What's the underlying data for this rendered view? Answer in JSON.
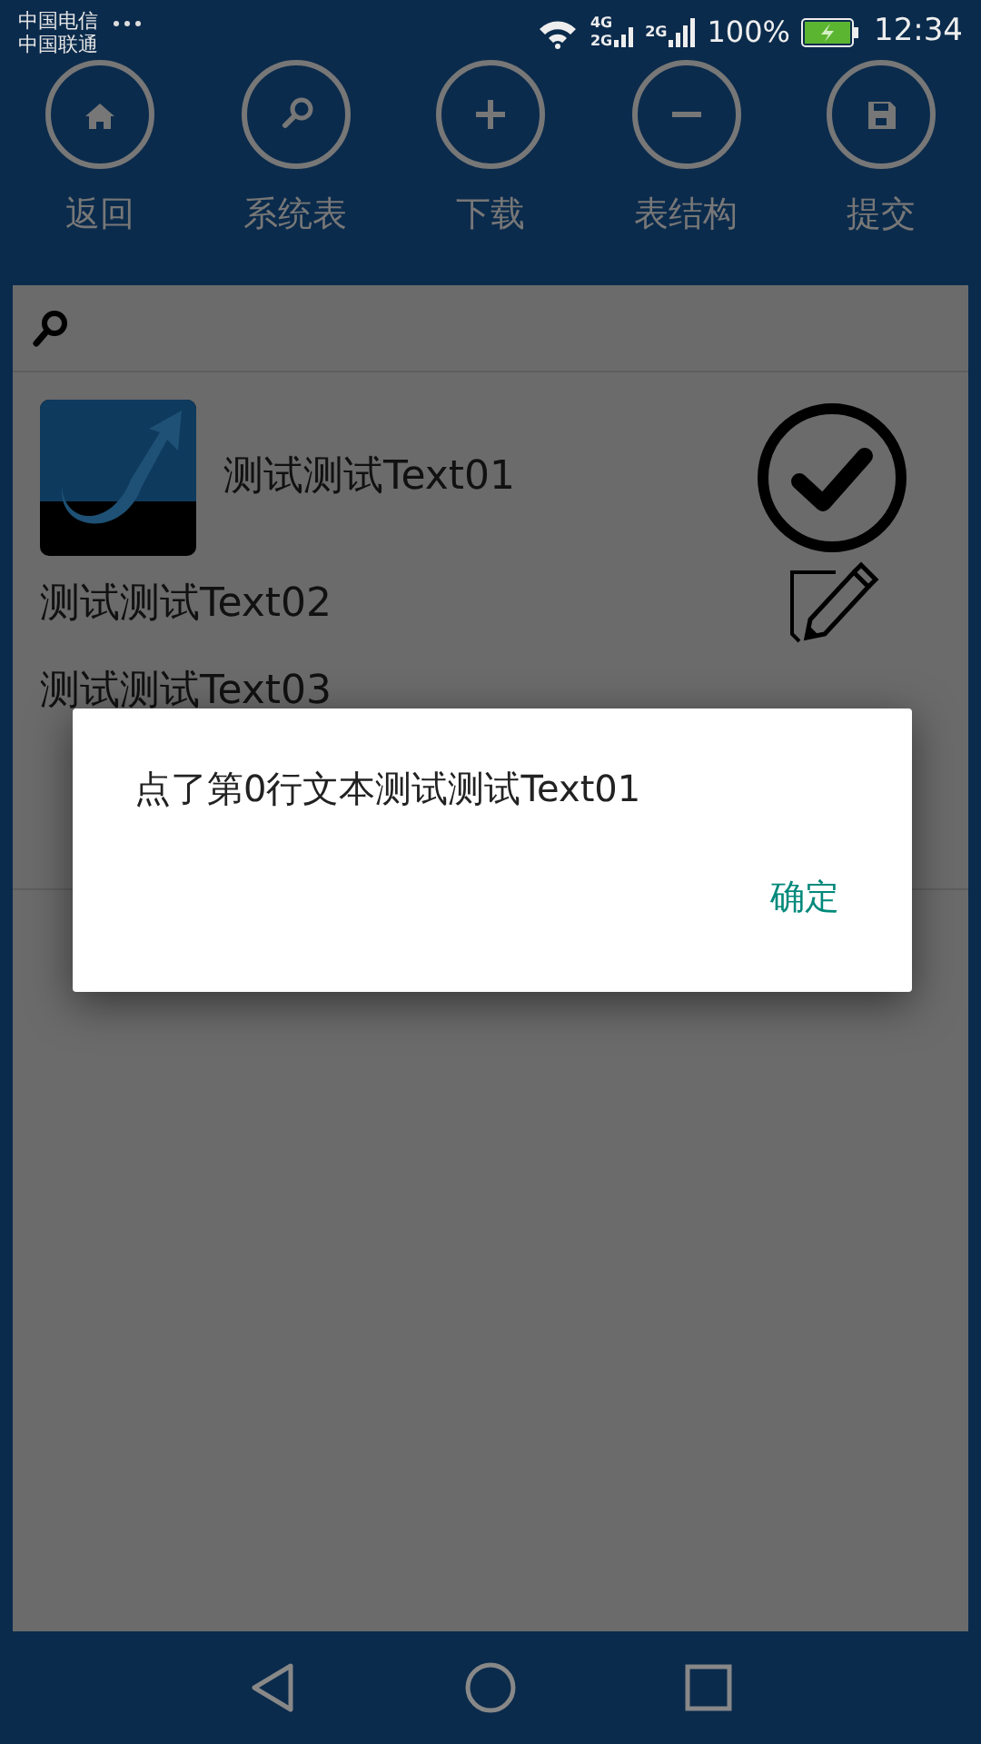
{
  "status_bar": {
    "carriers": [
      "中国电信",
      "中国联通"
    ],
    "signals": [
      {
        "labels": [
          "4G",
          "2G"
        ]
      },
      {
        "labels": [
          "2G"
        ]
      }
    ],
    "battery": "100%",
    "time": "12:34"
  },
  "toolbar": [
    {
      "label": "返回",
      "kind": "home"
    },
    {
      "label": "系统表",
      "kind": "search"
    },
    {
      "label": "下载",
      "kind": "plus"
    },
    {
      "label": "表结构",
      "kind": "minus"
    },
    {
      "label": "提交",
      "kind": "save"
    }
  ],
  "list": [
    {
      "text": "测试测试Text01",
      "kind": "thumbnail"
    },
    {
      "text": "测试测试Text02",
      "kind": "plain"
    },
    {
      "text": "测试测试Text03",
      "kind": "plain"
    }
  ],
  "dialog": {
    "message": "点了第0行文本测试测试Text01",
    "button": "确定"
  }
}
